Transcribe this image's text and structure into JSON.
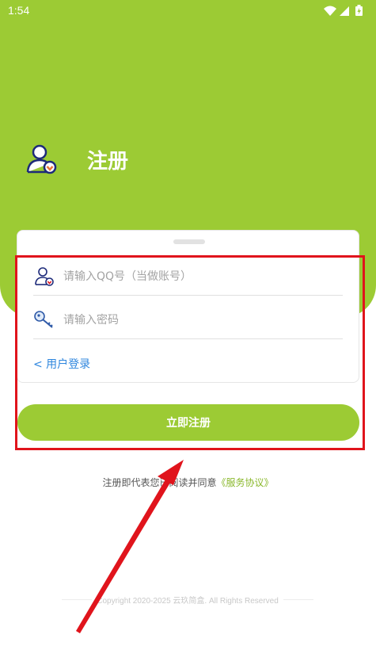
{
  "status_bar": {
    "time": "1:54"
  },
  "header": {
    "title": "注册"
  },
  "form": {
    "qq_placeholder": "请输入QQ号（当做账号）",
    "password_placeholder": "请输入密码",
    "login_link": "< 用户登录",
    "submit_label": "立即注册"
  },
  "agreement": {
    "prefix": "注册即代表您已阅读并同意",
    "link": "《服务协议》"
  },
  "footer": {
    "copyright": "Copyright 2020-2025 云玖简盒. All Rights Reserved"
  },
  "colors": {
    "brand": "#9ccb34",
    "link": "#2e86de",
    "highlight": "#e0141c"
  }
}
